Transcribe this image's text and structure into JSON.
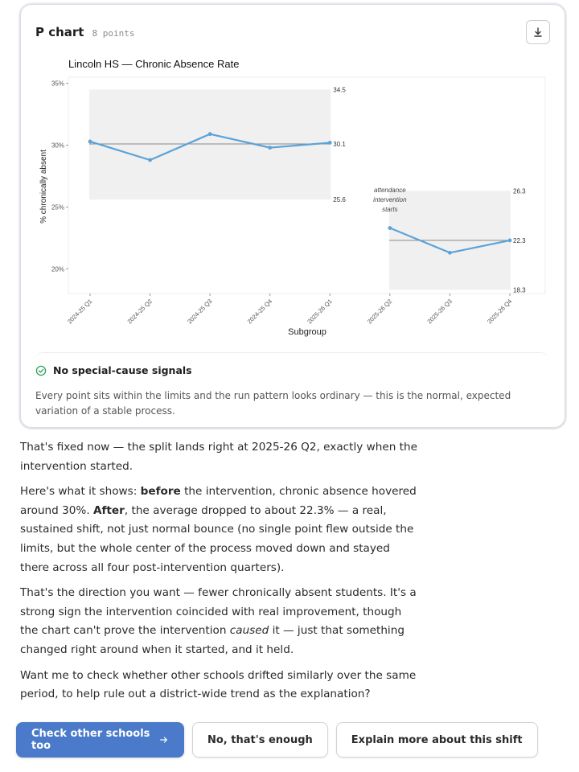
{
  "card": {
    "title": "P chart",
    "subtitle": "8 points",
    "download_icon": "download-icon"
  },
  "chart_data": {
    "type": "line",
    "title": "Lincoln HS — Chronic Absence Rate",
    "xlabel": "Subgroup",
    "ylabel": "% chronically absent",
    "categories": [
      "2024-25 Q1",
      "2024-25 Q2",
      "2024-25 Q3",
      "2024-25 Q4",
      "2025-26 Q1",
      "2025-26 Q2",
      "2025-26 Q3",
      "2025-26 Q4"
    ],
    "values": [
      30.3,
      28.8,
      30.9,
      29.8,
      30.2,
      23.3,
      21.3,
      22.3
    ],
    "ylim": [
      18,
      35.5
    ],
    "yticks": [
      20,
      25,
      30,
      35
    ],
    "ytick_labels": [
      "20%",
      "25%",
      "30%",
      "35%"
    ],
    "phases": [
      {
        "start": 0,
        "end": 4,
        "center": 30.1,
        "ucl": 34.5,
        "lcl": 25.6,
        "center_label": "30.1",
        "ucl_label": "34.5",
        "lcl_label": "25.6"
      },
      {
        "start": 5,
        "end": 7,
        "center": 22.3,
        "ucl": 26.3,
        "lcl": 18.3,
        "center_label": "22.3",
        "ucl_label": "26.3",
        "lcl_label": "18.3"
      }
    ],
    "annotation": {
      "lines": [
        "attendance",
        "intervention",
        "starts"
      ],
      "at_index": 5
    },
    "colors": {
      "line": "#5ba3d9",
      "band": "#f0f0f0",
      "center": "#888888"
    }
  },
  "signal": {
    "icon": "check-circle-icon",
    "title": "No special-cause signals",
    "text": "Every point sits within the limits and the run pattern looks ordinary — this is the normal, expected variation of a stable process."
  },
  "message": {
    "p1": "That's fixed now — the split lands right at 2025-26 Q2, exactly when the intervention started.",
    "p2_a": "Here's what it shows: ",
    "p2_b": "before",
    "p2_c": " the intervention, chronic absence hovered around 30%. ",
    "p2_d": "After",
    "p2_e": ", the average dropped to about 22.3% — a real, sustained shift, not just normal bounce (no single point flew outside the limits, but the whole center of the process moved down and stayed there across all four post-intervention quarters).",
    "p3_a": "That's the direction you want — fewer chronically absent students. It's a strong sign the intervention coincided with real improvement, though the chart can't prove the intervention ",
    "p3_b": "caused",
    "p3_c": " it — just that something changed right around when it started, and it held.",
    "p4": "Want me to check whether other schools drifted similarly over the same period, to help rule out a district-wide trend as the explanation?"
  },
  "actions": {
    "primary": "Check other schools too",
    "primary_icon": "arrow-right-icon",
    "secondary1": "No, that's enough",
    "secondary2": "Explain more about this shift"
  }
}
